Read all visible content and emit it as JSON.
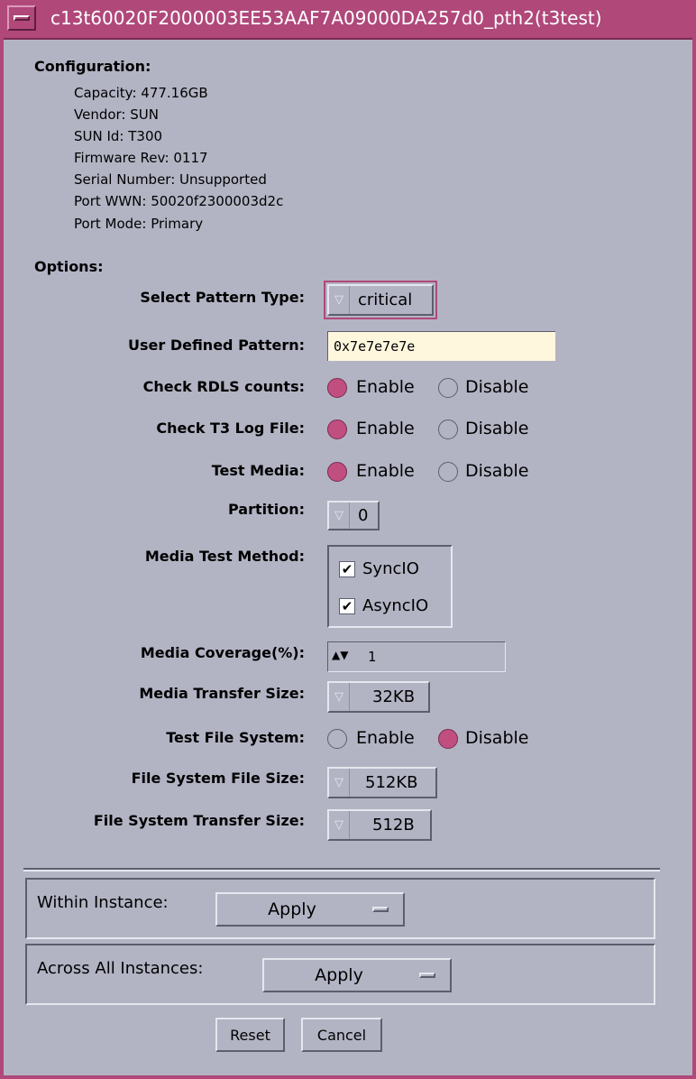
{
  "window": {
    "title": "c13t60020F2000003EE53AAF7A09000DA257d0_pth2(t3test)"
  },
  "configuration": {
    "heading": "Configuration:",
    "items": [
      "Capacity: 477.16GB",
      "Vendor: SUN",
      "SUN Id: T300",
      "Firmware Rev: 0117",
      "Serial Number: Unsupported",
      "Port WWN: 50020f2300003d2c",
      "Port Mode: Primary"
    ]
  },
  "options": {
    "heading": "Options:",
    "select_pattern_type": {
      "label": "Select Pattern Type:",
      "value": "critical"
    },
    "user_defined_pattern": {
      "label": "User Defined Pattern:",
      "value": "0x7e7e7e7e"
    },
    "check_rdls_counts": {
      "label": "Check RDLS counts:",
      "enable": "Enable",
      "disable": "Disable",
      "selected": "Enable"
    },
    "check_t3_log_file": {
      "label": "Check T3 Log File:",
      "enable": "Enable",
      "disable": "Disable",
      "selected": "Enable"
    },
    "test_media": {
      "label": "Test Media:",
      "enable": "Enable",
      "disable": "Disable",
      "selected": "Enable"
    },
    "partition": {
      "label": "Partition:",
      "value": "0"
    },
    "media_test_method": {
      "label": "Media Test Method:",
      "options": [
        {
          "label": "SyncIO",
          "checked": true
        },
        {
          "label": "AsyncIO",
          "checked": true
        }
      ]
    },
    "media_coverage": {
      "label": "Media Coverage(%):",
      "value": "1"
    },
    "media_transfer_size": {
      "label": "Media Transfer Size:",
      "value": "32KB"
    },
    "test_file_system": {
      "label": "Test File System:",
      "enable": "Enable",
      "disable": "Disable",
      "selected": "Disable"
    },
    "file_system_file_size": {
      "label": "File System File Size:",
      "value": "512KB"
    },
    "file_system_transfer_size": {
      "label": "File System Transfer Size:",
      "value": "512B"
    }
  },
  "within_instance": {
    "label": "Within Instance:",
    "button": "Apply"
  },
  "across_all_instances": {
    "label": "Across All Instances:",
    "button": "Apply"
  },
  "buttons": {
    "reset": "Reset",
    "cancel": "Cancel"
  },
  "colors": {
    "accent": "#b0487a",
    "background": "#b2b4c4",
    "field": "#fef7dd"
  },
  "icons": {
    "window_menu": "window-menu-icon",
    "dropdown": "dropdown-arrow-icon",
    "spin": "spin-arrows-icon",
    "check": "checkmark-icon"
  }
}
